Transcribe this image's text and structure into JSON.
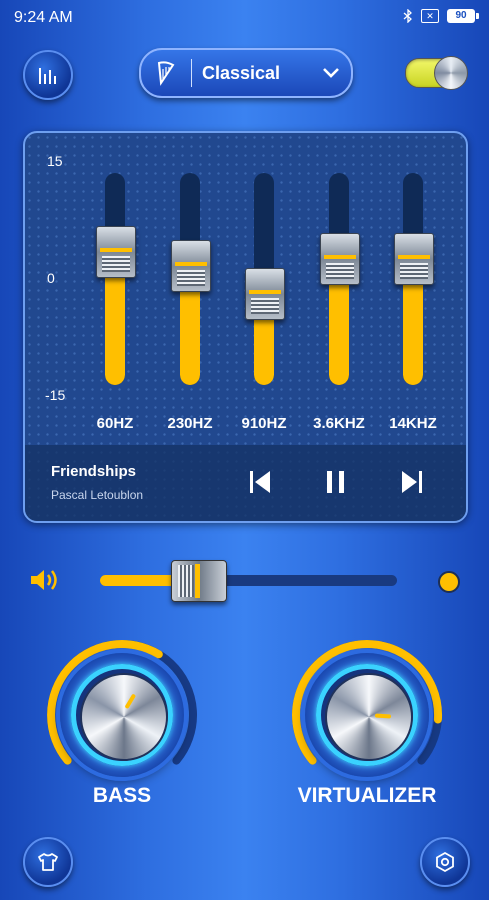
{
  "status_bar": {
    "time": "9:24  AM",
    "battery": "90"
  },
  "header": {
    "preset_label": "Classical"
  },
  "eq": {
    "scale": {
      "top": "15",
      "mid": "0",
      "bottom": "-15"
    },
    "bands": [
      {
        "label": "60HZ",
        "gain_db": 4
      },
      {
        "label": "230HZ",
        "gain_db": 2
      },
      {
        "label": "910HZ",
        "gain_db": -2
      },
      {
        "label": "3.6KHZ",
        "gain_db": 3
      },
      {
        "label": "14KHZ",
        "gain_db": 3
      }
    ]
  },
  "player": {
    "title": "Friendships",
    "artist": "Pascal Letoublon"
  },
  "volume": {
    "level": 0.33
  },
  "knobs": {
    "bass": {
      "label": "BASS",
      "level": 0.62
    },
    "virtualizer": {
      "label": "VIRTUALIZER",
      "level": 0.86
    }
  },
  "colors": {
    "accent": "#ffbf00",
    "track": "#0f2a56"
  }
}
